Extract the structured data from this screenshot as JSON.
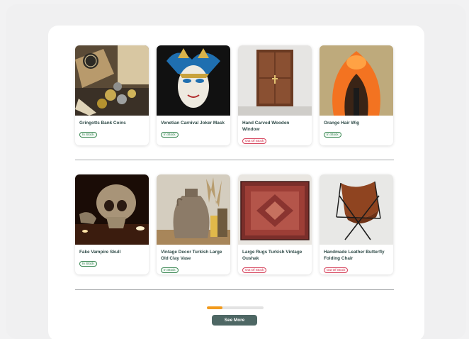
{
  "products": [
    {
      "name": "Gringotts Bank Coins",
      "stock": "In Stock",
      "in_stock": true,
      "image": "coins-image"
    },
    {
      "name": "Venetian Carnival Joker Mask",
      "stock": "In Stock",
      "in_stock": true,
      "image": "joker-mask-image"
    },
    {
      "name": "Hand Carved Wooden Window",
      "stock": "Out Of Stock",
      "in_stock": false,
      "image": "wooden-window-image"
    },
    {
      "name": "Orange Hair Wig",
      "stock": "In Stock",
      "in_stock": true,
      "image": "orange-wig-image"
    },
    {
      "name": "Fake Vampire Skull",
      "stock": "In Stock",
      "in_stock": true,
      "image": "skull-image"
    },
    {
      "name": "Vintage Decor Turkish Large Old Clay Vase",
      "stock": "In Stock",
      "in_stock": true,
      "image": "clay-vase-image"
    },
    {
      "name": "Large Rugs Turkish Vintage Oushak",
      "stock": "Out Of Stock",
      "in_stock": false,
      "image": "rug-image"
    },
    {
      "name": "Handmade Leather Butterfly Folding Chair",
      "stock": "Out Of Stock",
      "in_stock": false,
      "image": "leather-chair-image"
    }
  ],
  "pagination": {
    "progress_fraction": 0.27,
    "see_more_label": "See More"
  },
  "colors": {
    "in_stock": "#2f7a4a",
    "out_of_stock": "#cc2c47",
    "progress": "#f29a1c",
    "button": "#4e6764"
  }
}
